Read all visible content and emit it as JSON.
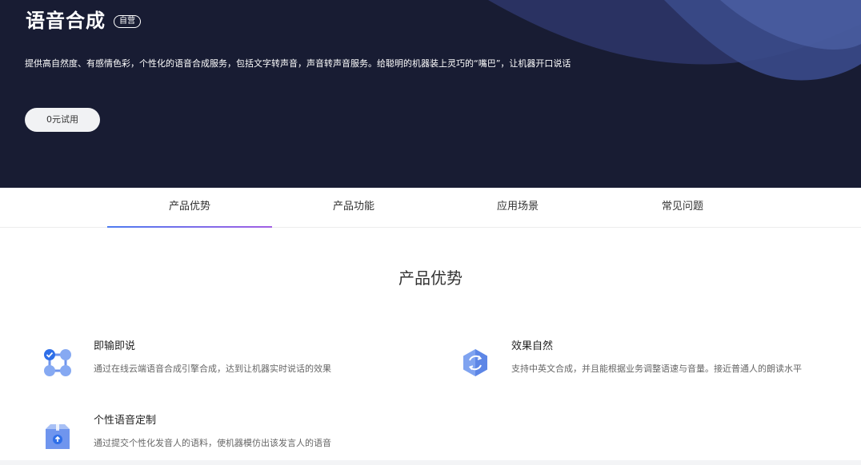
{
  "hero": {
    "title": "语音合成",
    "badge": "自营",
    "description": "提供高自然度、有感情色彩，个性化的语音合成服务，包括文字转声音，声音转声音服务。给聪明的机器装上灵巧的“嘴巴”，让机器开口说话",
    "trial_button": "0元试用",
    "colors": {
      "background": "#181c33",
      "accent": "#2b3566"
    }
  },
  "tabs": [
    {
      "label": "产品优势",
      "active": true
    },
    {
      "label": "产品功能",
      "active": false
    },
    {
      "label": "应用场景",
      "active": false
    },
    {
      "label": "常见问题",
      "active": false
    }
  ],
  "section": {
    "title": "产品优势",
    "features": [
      {
        "name": "即输即说",
        "description": "通过在线云端语音合成引擎合成，达到让机器实时说话的效果",
        "icon": "nodes-icon"
      },
      {
        "name": "效果自然",
        "description": "支持中英文合成，并且能根据业务调整语速与音量。接近普通人的朗读水平",
        "icon": "refresh-hexagon-icon"
      },
      {
        "name": "个性语音定制",
        "description": "通过提交个性化发音人的语料，使机器模仿出该发言人的语音",
        "icon": "package-upload-icon"
      }
    ]
  }
}
